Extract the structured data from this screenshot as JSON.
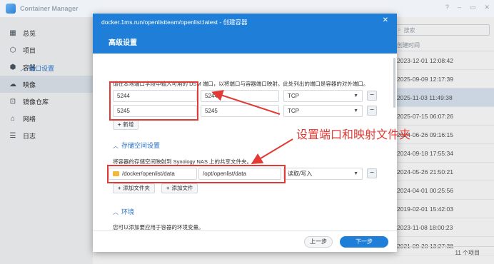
{
  "app": {
    "title": "Container Manager",
    "controls": [
      "?",
      "–",
      "▭",
      "✕"
    ]
  },
  "sidebar": {
    "items": [
      {
        "label": "总览",
        "icon": "overview-icon",
        "glyph": "▦",
        "active": false
      },
      {
        "label": "项目",
        "icon": "project-icon",
        "glyph": "⬡",
        "active": false
      },
      {
        "label": "容器",
        "icon": "container-icon",
        "glyph": "⬢",
        "active": false
      },
      {
        "label": "映像",
        "icon": "cloud-icon",
        "glyph": "☁",
        "active": true
      },
      {
        "label": "镜像仓库",
        "icon": "registry-icon",
        "glyph": "⊡",
        "active": false
      },
      {
        "label": "网络",
        "icon": "network-icon",
        "glyph": "⌂",
        "active": false
      },
      {
        "label": "日志",
        "icon": "log-icon",
        "glyph": "☰",
        "active": false
      }
    ]
  },
  "list": {
    "search_placeholder": "搜索",
    "column": "创建时间",
    "rows": [
      "2023-12-01 12:08:42",
      "2025-09-09 12:17:39",
      "2025-11-03 11:49:38",
      "2025-07-15 06:07:26",
      "2024-06-26 09:16:15",
      "2024-09-18 17:55:34",
      "2024-05-26 21:50:21",
      "2024-04-01 00:25:56",
      "2019-02-01 15:42:03",
      "2023-11-08 18:00:23",
      "2021-09-20 13:27:38"
    ],
    "selected_index": 2,
    "footer": "11 个项目"
  },
  "modal": {
    "title": "docker.1ms.run/openlistteam/openlist:latest - 创建容器",
    "header": "高级设置",
    "port_section": {
      "title": "端口设置",
      "desc": "请在本地端口字段中输入可用的 DSM 端口，以将端口与容器端口映射。此处列出的端口是容器的对外端口。",
      "rows": [
        {
          "local": "5244",
          "container": "5244",
          "protocol": "TCP"
        },
        {
          "local": "5245",
          "container": "5245",
          "protocol": "TCP"
        }
      ],
      "add_label": "新增"
    },
    "storage_section": {
      "title": "存储空间设置",
      "desc": "将容器的存储空间映射到 Synology NAS 上的共享文件夹。",
      "rows": [
        {
          "host": "/docker/openlist/data",
          "container": "/opt/openlist/data",
          "mode": "读取/写入"
        }
      ],
      "add_folder_label": "添加文件夹",
      "add_file_label": "添加文件"
    },
    "env_section": {
      "title": "环境",
      "desc": "您可以添加要应用于容器的环境变量。"
    },
    "prev_label": "上一步",
    "next_label": "下一步"
  },
  "annotation": {
    "text": "设置端口和映射文件夹",
    "color": "#e23b35"
  },
  "colors": {
    "primary": "#1f7fd8",
    "annotation": "#e23b35",
    "folder": "#f2b838"
  }
}
